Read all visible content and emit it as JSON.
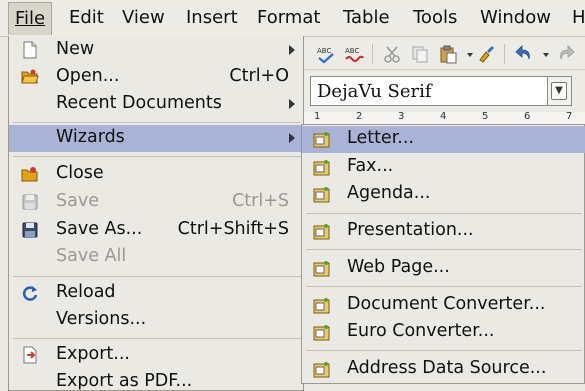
{
  "menubar": {
    "items": [
      "File",
      "Edit",
      "View",
      "Insert",
      "Format",
      "Table",
      "Tools",
      "Window",
      "H"
    ]
  },
  "toolbar": {
    "font_name": "DejaVu Serif"
  },
  "ruler": {
    "marks": [
      "1",
      "2",
      "3",
      "4",
      "5",
      "6",
      "7"
    ]
  },
  "file_menu": {
    "new": "New",
    "open": "Open...",
    "open_accel": "Ctrl+O",
    "recent": "Recent Documents",
    "wizards": "Wizards",
    "close": "Close",
    "save": "Save",
    "save_accel": "Ctrl+S",
    "save_as": "Save As...",
    "save_as_accel": "Ctrl+Shift+S",
    "save_all": "Save All",
    "reload": "Reload",
    "versions": "Versions...",
    "export": "Export...",
    "export_pdf": "Export as PDF..."
  },
  "wizards_menu": {
    "letter": "Letter...",
    "fax": "Fax...",
    "agenda": "Agenda...",
    "presentation": "Presentation...",
    "web_page": "Web Page...",
    "document_converter": "Document Converter...",
    "euro_converter": "Euro Converter...",
    "address_data_source": "Address Data Source..."
  },
  "colors": {
    "highlight": "#aab3d5",
    "menu_bg": "#ebe9e3"
  }
}
